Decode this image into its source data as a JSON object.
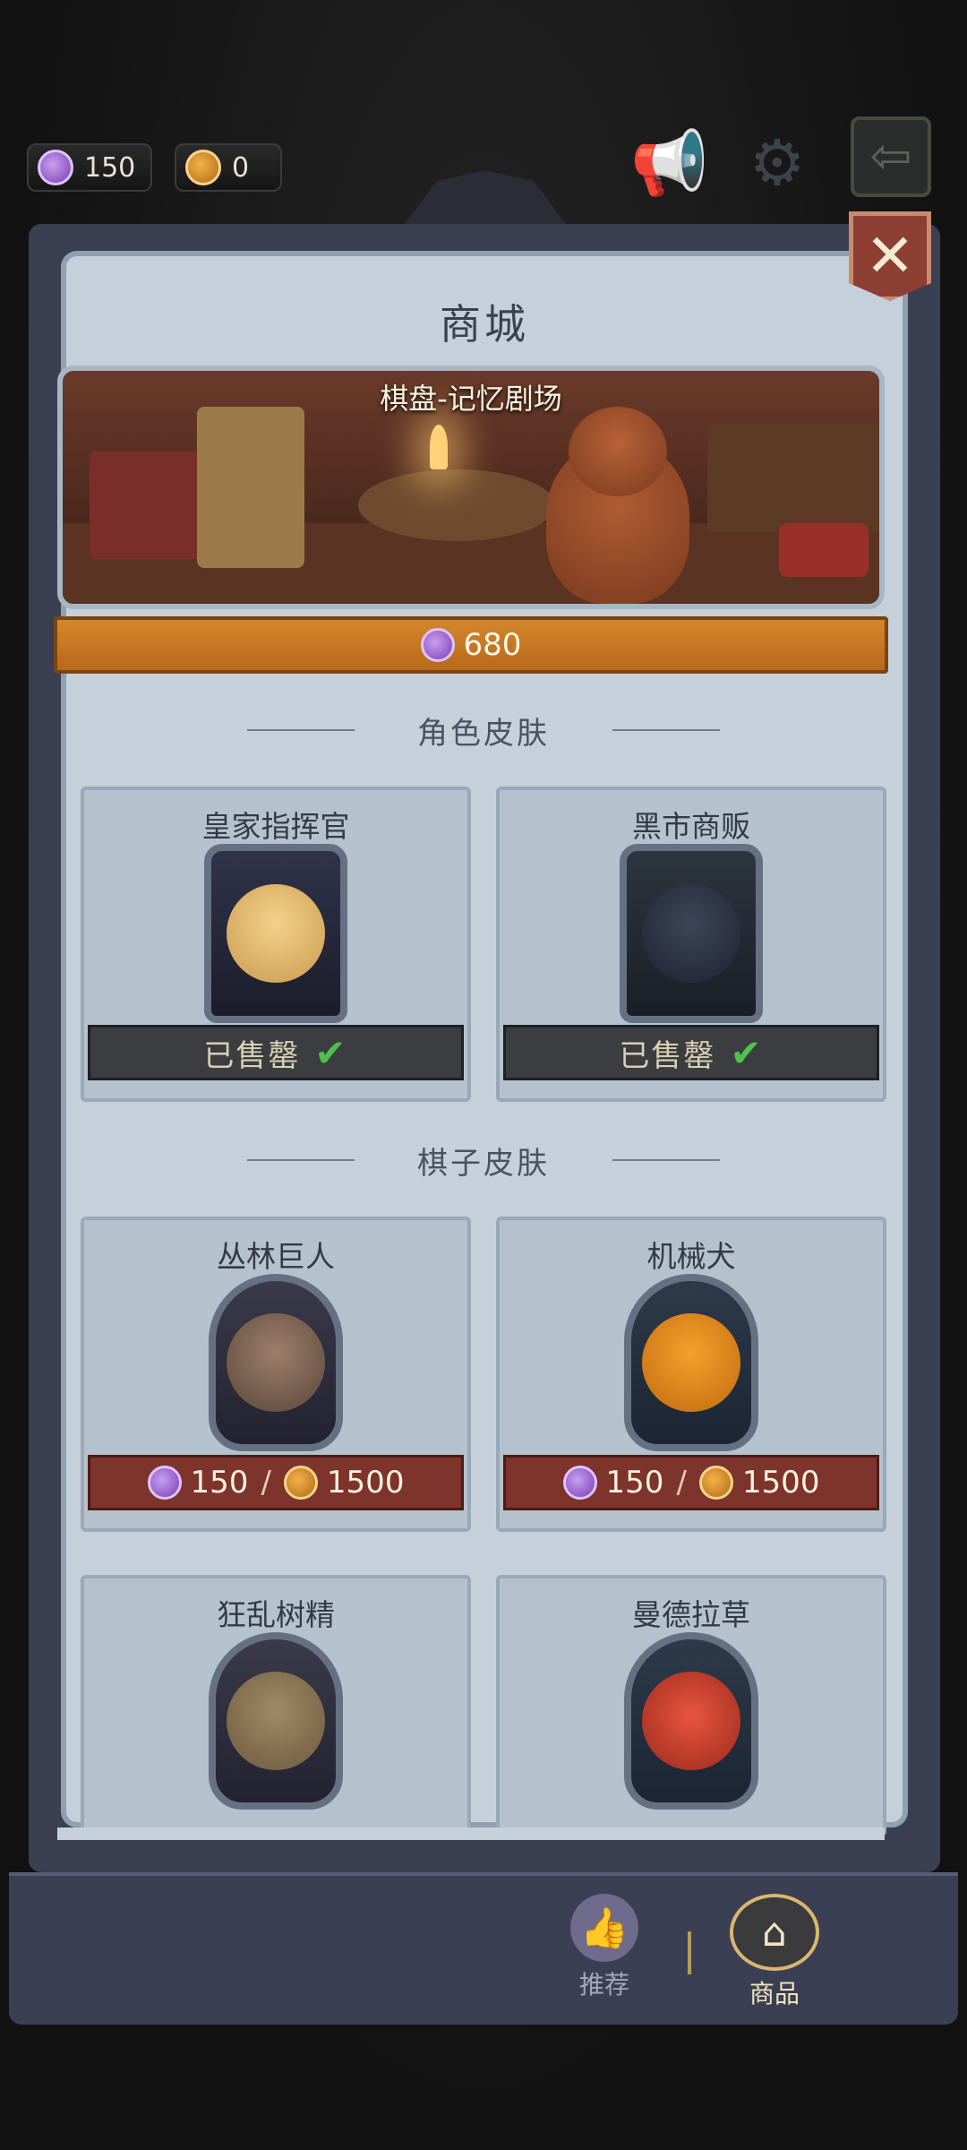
{
  "hud": {
    "candy_count": "150",
    "pumpkin_count": "0",
    "icons": [
      "candy-icon",
      "pumpkin-icon",
      "megaphone-icon",
      "gear-icon",
      "back-arrow-icon"
    ]
  },
  "shop": {
    "title": "商城",
    "close_label": "✕",
    "banner": {
      "title": "棋盘-记忆剧场",
      "price": "680"
    },
    "sections": {
      "character_skins": "角色皮肤",
      "piece_skins": "棋子皮肤"
    },
    "character_skins": [
      {
        "name": "皇家指挥官",
        "status": "已售罄"
      },
      {
        "name": "黑市商贩",
        "status": "已售罄"
      }
    ],
    "piece_skins": [
      {
        "name": "丛林巨人",
        "price_candy": "150",
        "price_pumpkin": "1500"
      },
      {
        "name": "机械犬",
        "price_candy": "150",
        "price_pumpkin": "1500"
      },
      {
        "name": "狂乱树精"
      },
      {
        "name": "曼德拉草"
      }
    ],
    "price_separator": "/"
  },
  "tabs": {
    "recommend": "推荐",
    "goods": "商品",
    "active": "goods"
  },
  "colors": {
    "accent_orange": "#c47621",
    "price_red": "#7c342c",
    "sold_out_check": "#4cc24a"
  }
}
